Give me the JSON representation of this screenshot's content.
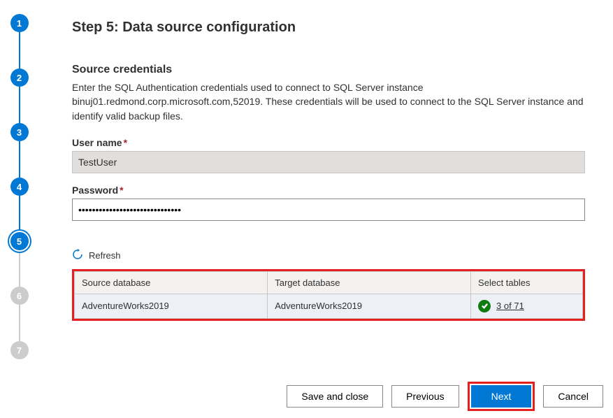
{
  "stepper": {
    "steps": [
      "1",
      "2",
      "3",
      "4",
      "5",
      "6",
      "7"
    ],
    "current": 5
  },
  "header": {
    "title": "Step 5: Data source configuration"
  },
  "credentials": {
    "heading": "Source credentials",
    "description": "Enter the SQL Authentication credentials used to connect to SQL Server instance binuj01.redmond.corp.microsoft.com,52019. These credentials will be used to connect to the SQL Server instance and identify valid backup files.",
    "username_label": "User name",
    "username_value": "TestUser",
    "password_label": "Password",
    "password_value": "••••••••••••••••••••••••••••••"
  },
  "refresh": {
    "label": "Refresh"
  },
  "table": {
    "headers": {
      "source": "Source database",
      "target": "Target database",
      "select": "Select tables"
    },
    "rows": [
      {
        "source": "AdventureWorks2019",
        "target": "AdventureWorks2019",
        "select": "3 of 71"
      }
    ]
  },
  "footer": {
    "save_close": "Save and close",
    "previous": "Previous",
    "next": "Next",
    "cancel": "Cancel"
  }
}
